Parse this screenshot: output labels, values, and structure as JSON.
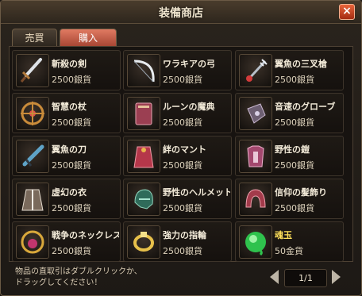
{
  "window": {
    "title": "装備商店",
    "close_label": "×"
  },
  "tabs": [
    {
      "label": "売買",
      "active": false
    },
    {
      "label": "購入",
      "active": true
    }
  ],
  "items": [
    {
      "name": "斬殺の剣",
      "price": "2500銀貨",
      "icon": "sword-icon"
    },
    {
      "name": "ワラキアの弓",
      "price": "2500銀貨",
      "icon": "bow-icon"
    },
    {
      "name": "翼魚の三叉槍",
      "price": "2500銀貨",
      "icon": "trident-icon"
    },
    {
      "name": "智慧の杖",
      "price": "2500銀貨",
      "icon": "staff-icon"
    },
    {
      "name": "ルーンの魔典",
      "price": "2500銀貨",
      "icon": "tome-icon"
    },
    {
      "name": "音速のグローブ",
      "price": "2500銀貨",
      "icon": "gauntlet-icon"
    },
    {
      "name": "翼魚の刀",
      "price": "2500銀貨",
      "icon": "blade-icon"
    },
    {
      "name": "絆のマント",
      "price": "2500銀貨",
      "icon": "cloak-icon"
    },
    {
      "name": "野性の鎧",
      "price": "2500銀貨",
      "icon": "armor-icon"
    },
    {
      "name": "虚幻の衣",
      "price": "2500銀貨",
      "icon": "robe-icon"
    },
    {
      "name": "野性のヘルメット",
      "price": "2500銀貨",
      "icon": "helmet-icon"
    },
    {
      "name": "信仰の髪飾り",
      "price": "2500銀貨",
      "icon": "headdress-icon"
    },
    {
      "name": "戦争のネックレス",
      "price": "2500銀貨",
      "icon": "necklace-icon"
    },
    {
      "name": "強力の指輪",
      "price": "2500銀貨",
      "icon": "ring-icon"
    },
    {
      "name": "魂玉",
      "price": "50金貨",
      "icon": "soul-orb-icon",
      "highlight": true
    }
  ],
  "footer": {
    "hint_line1": "物品の直取引はダブルクリックか、",
    "hint_line2": "ドラッグしてください！",
    "page": "1/1"
  },
  "colors": {
    "accent_tab": "#c45a44",
    "gold_text": "#ffe05a",
    "close_button": "#d04a23"
  }
}
